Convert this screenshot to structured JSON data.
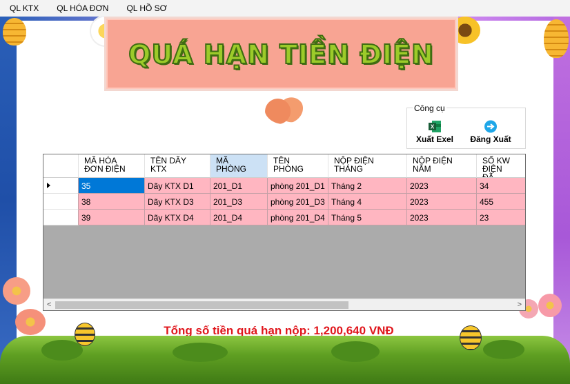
{
  "menu": {
    "items": [
      "QL KTX",
      "QL HÓA ĐƠN",
      "QL HỒ SƠ"
    ]
  },
  "banner": {
    "title": "QUÁ HẠN TIỀN ĐIỆN"
  },
  "tools": {
    "caption": "Công cụ",
    "export_label": "Xuất Exel",
    "logout_label": "Đăng Xuất",
    "export_icon": "excel-icon",
    "logout_icon": "logout-arrow-icon"
  },
  "grid": {
    "columns": [
      "MÃ HÓA\nĐƠN ĐIỆN",
      "TÊN DÃY\nKTX",
      "MÃ\nPHÒNG",
      "TÊN\nPHÒNG",
      "NỘP ĐIỆN\nTHÁNG",
      "NỘP ĐIỆN\nNĂM",
      "SỐ KW ĐIỆN\nĐÃ DÙNG"
    ],
    "selected_column": 2,
    "rows": [
      [
        "35",
        "Dãy KTX D1",
        "201_D1",
        "phòng 201_D1",
        "Tháng 2",
        "2023",
        "34"
      ],
      [
        "38",
        "Dãy KTX D3",
        "201_D3",
        "phòng 201_D3",
        "Tháng 4",
        "2023",
        "455"
      ],
      [
        "39",
        "Dãy KTX D4",
        "201_D4",
        "phòng 201_D4",
        "Tháng 5",
        "2023",
        "23"
      ]
    ],
    "scroll_left": "<",
    "scroll_right": ">"
  },
  "summary": {
    "total_text": "Tổng số tiền quá hạn nộp: 1,200,640 VNĐ"
  },
  "colors": {
    "row_bg": "#ffb6c1",
    "active_cell": "#0078d7",
    "total_text": "#e0161c",
    "banner_bg": "#f8a493",
    "banner_title": "#9ccb2a"
  }
}
